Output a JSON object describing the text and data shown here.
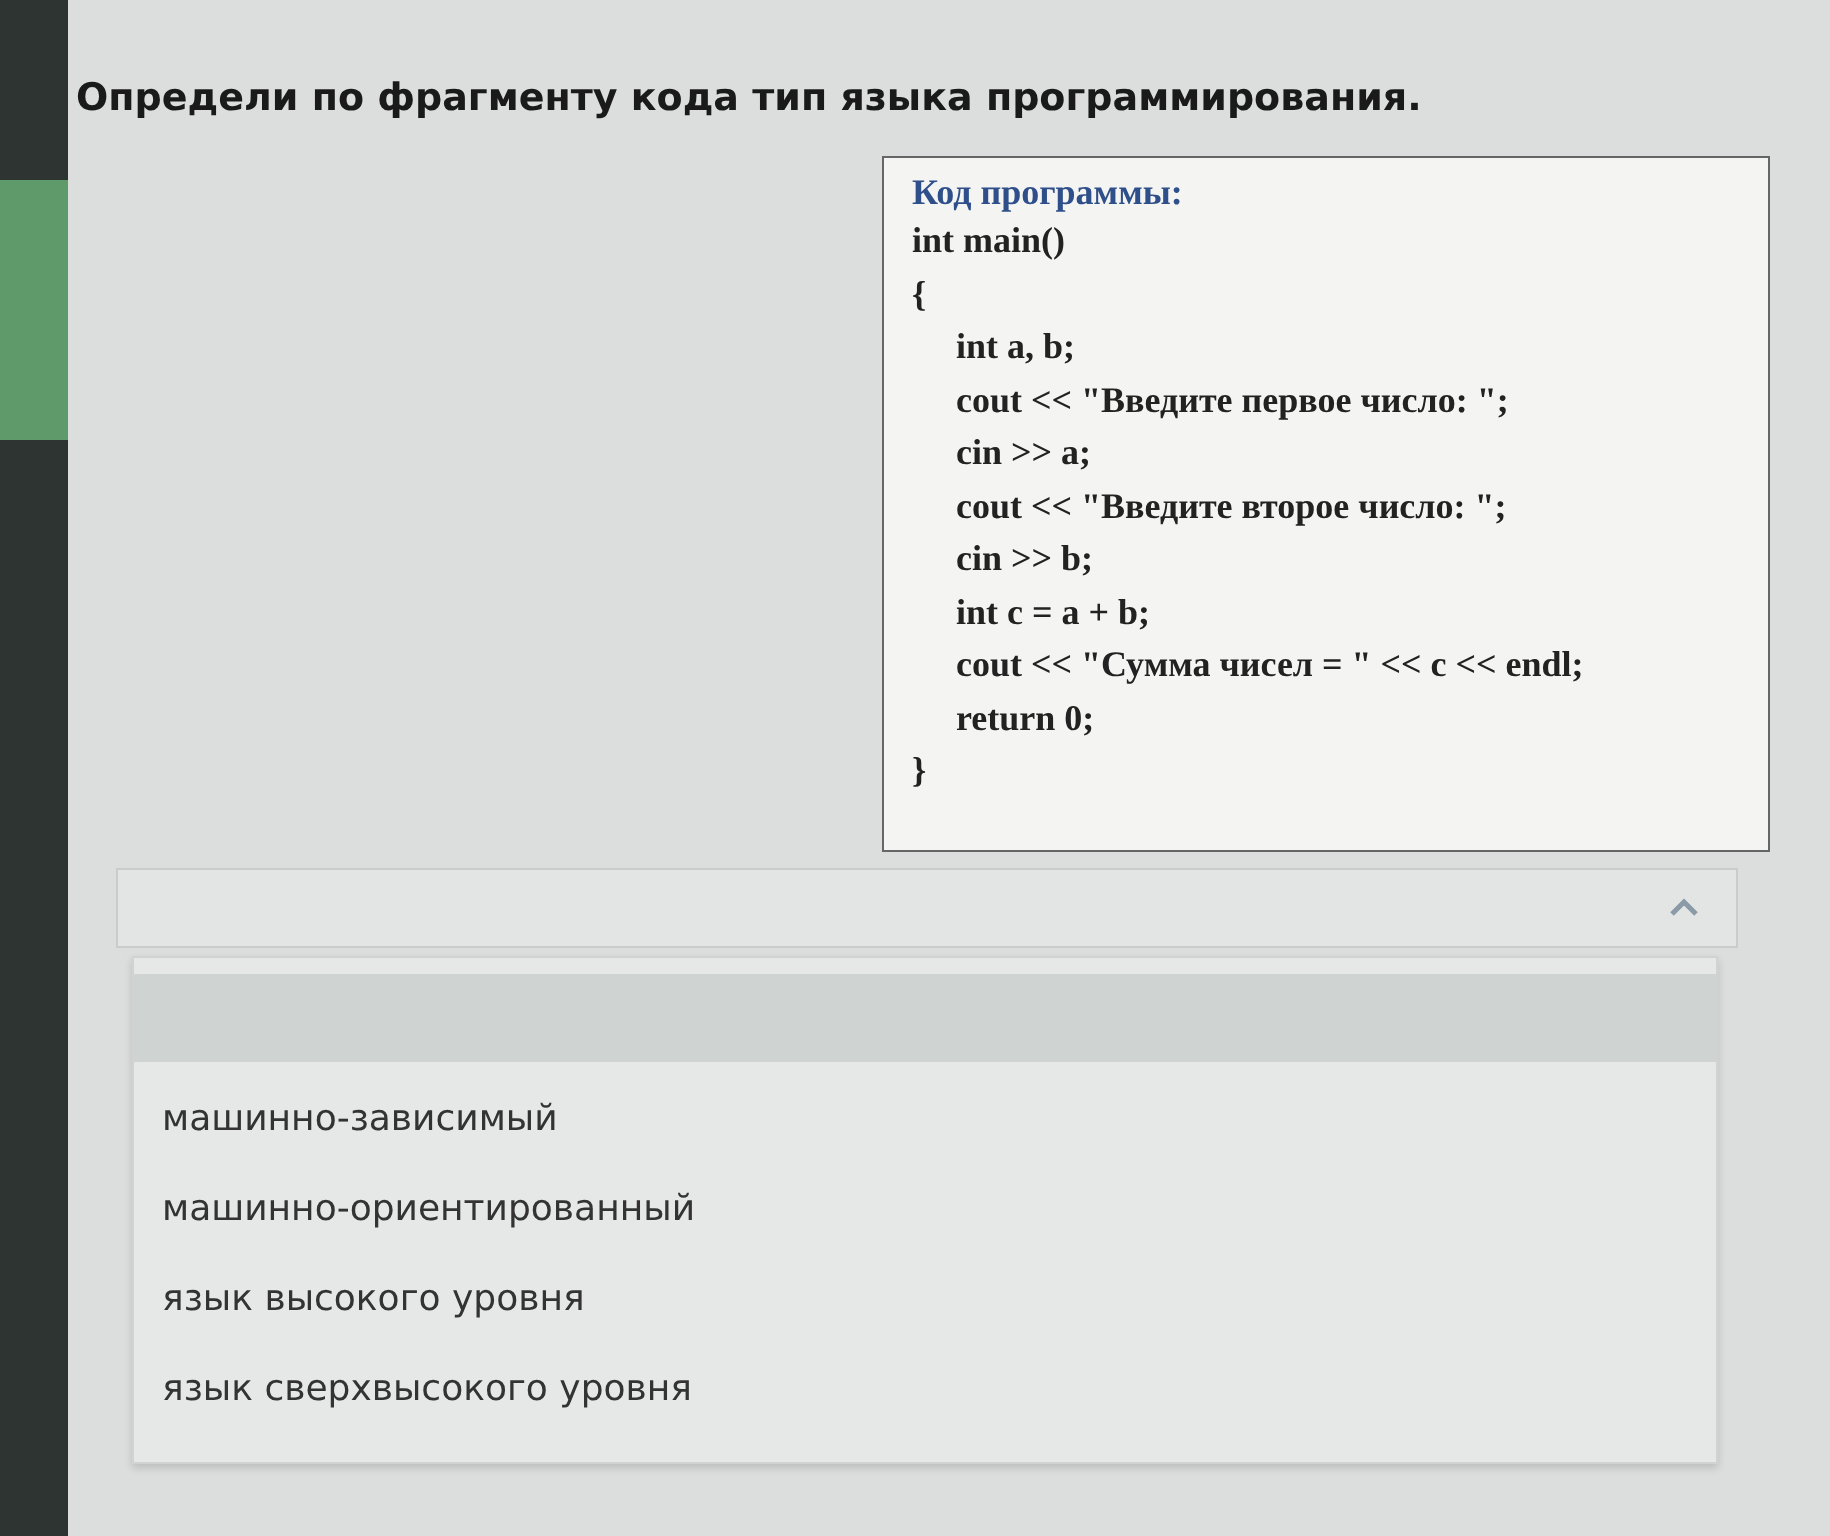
{
  "question": "Определи по фрагменту кода тип языка программирования.",
  "code": {
    "heading": "Код программы:",
    "lines": [
      {
        "text": "int main()",
        "indented": false
      },
      {
        "text": "{",
        "indented": false
      },
      {
        "text": "int a, b;",
        "indented": true
      },
      {
        "text": "cout << \"Введите первое число: \";",
        "indented": true
      },
      {
        "text": "cin >> a;",
        "indented": true
      },
      {
        "text": "cout << \"Введите второе число: \";",
        "indented": true
      },
      {
        "text": "cin >> b;",
        "indented": true
      },
      {
        "text": "int c = a + b;",
        "indented": true
      },
      {
        "text": "cout << \"Сумма чисел = \" << c << endl;",
        "indented": true
      },
      {
        "text": "return 0;",
        "indented": true
      },
      {
        "text": "}",
        "indented": false
      }
    ]
  },
  "dropdown": {
    "expanded": true,
    "options": [
      {
        "label": "машинно-зависимый",
        "selected": false
      },
      {
        "label": "машинно-ориентированный",
        "selected": false
      },
      {
        "label": "язык высокого уровня",
        "selected": false
      },
      {
        "label": "язык сверхвысокого уровня",
        "selected": false
      }
    ]
  }
}
